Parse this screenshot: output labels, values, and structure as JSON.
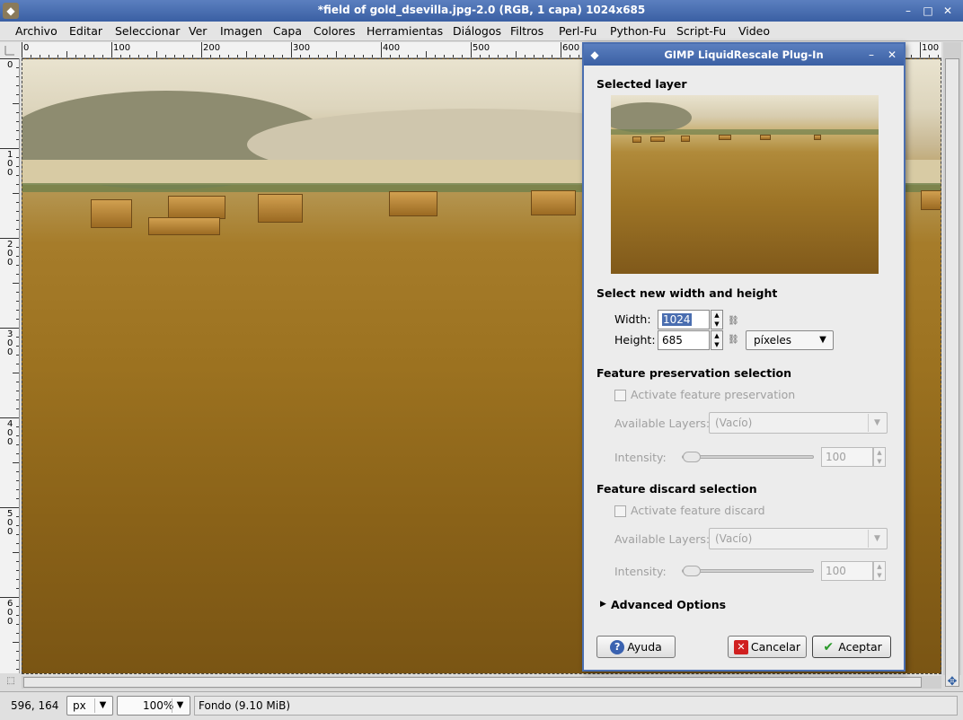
{
  "window": {
    "title": "*field of gold_dsevilla.jpg-2.0 (RGB, 1 capa) 1024x685",
    "minimize": "–",
    "maximize": "□",
    "close": "✕"
  },
  "menubar": {
    "items": [
      "Archivo",
      "Editar",
      "Seleccionar",
      "Ver",
      "Imagen",
      "Capa",
      "Colores",
      "Herramientas",
      "Diálogos",
      "Filtros",
      "Perl-Fu",
      "Python-Fu",
      "Script-Fu",
      "Video"
    ]
  },
  "hruler": {
    "labels": [
      "0",
      "100",
      "200",
      "300",
      "400",
      "500",
      "600",
      "100"
    ]
  },
  "vruler": {
    "labels": [
      "0",
      "100",
      "200",
      "300",
      "400",
      "500",
      "600"
    ]
  },
  "statusbar": {
    "coords": "596, 164",
    "unit": "px",
    "zoom": "100%",
    "message": "Fondo (9.10 MiB)"
  },
  "dialog": {
    "title": "GIMP LiquidRescale Plug-In",
    "minimize": "–",
    "close": "✕",
    "selected_layer": "Selected layer",
    "new_size": "Select new width and height",
    "width_label": "Width:",
    "width_value": "1024",
    "height_label": "Height:",
    "height_value": "685",
    "unit": "píxeles",
    "preservation": {
      "heading": "Feature preservation selection",
      "checkbox": "Activate feature preservation",
      "layers_label": "Available Layers:",
      "layers_value": "(Vacío)",
      "intensity_label": "Intensity:",
      "intensity_value": "100"
    },
    "discard": {
      "heading": "Feature discard selection",
      "checkbox": "Activate feature discard",
      "layers_label": "Available Layers:",
      "layers_value": "(Vacío)",
      "intensity_label": "Intensity:",
      "intensity_value": "100"
    },
    "advanced": "Advanced Options",
    "help": "Ayuda",
    "cancel": "Cancelar",
    "accept": "Aceptar"
  },
  "icons": [
    "gimp-app-icon",
    "help-icon",
    "cancel-icon",
    "accept-icon",
    "chain-link-icon",
    "expander-arrow-icon",
    "navigate-icon",
    "quick-mask-icon"
  ]
}
